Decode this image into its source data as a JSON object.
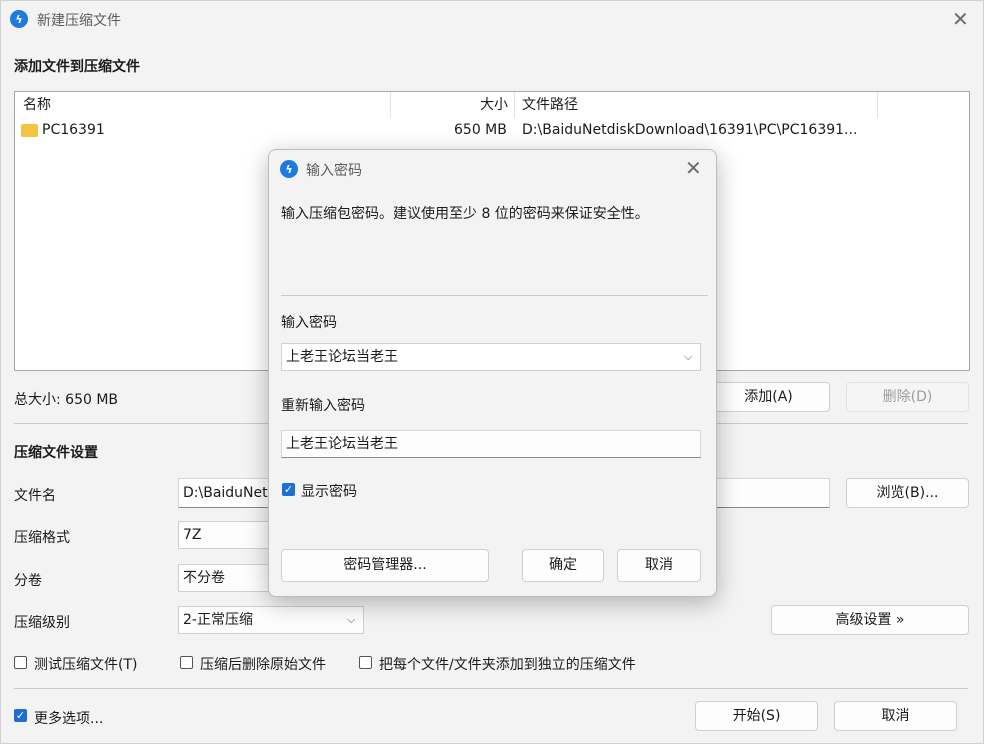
{
  "window": {
    "title": "新建压缩文件",
    "close": "✕"
  },
  "add_section": {
    "title": "添加文件到压缩文件",
    "columns": {
      "name": "名称",
      "size": "大小",
      "path": "文件路径"
    },
    "rows": [
      {
        "name": "PC16391",
        "size": "650 MB",
        "path": "D:\\BaiduNetdiskDownload\\16391\\PC\\PC16391..."
      }
    ],
    "total": "总大小: 650 MB",
    "add_label": "添加(A)",
    "delete_label": "删除(D)"
  },
  "settings": {
    "title": "压缩文件设置",
    "filename_label": "文件名",
    "filename_value": "D:\\BaiduNet",
    "browse_label": "浏览(B)...",
    "format_label": "压缩格式",
    "format_value": "7Z",
    "split_label": "分卷",
    "split_value": "不分卷",
    "level_label": "压缩级别",
    "level_value": "2-正常压缩",
    "advanced_label": "高级设置 »",
    "test_label": "测试压缩文件(T)",
    "delete_after_label": "压缩后删除原始文件",
    "separate_label": "把每个文件/文件夹添加到独立的压缩文件"
  },
  "footer": {
    "more_options": "更多选项...",
    "start": "开始(S)",
    "cancel": "取消"
  },
  "dialog": {
    "title": "输入密码",
    "description": "输入压缩包密码。建议使用至少 8 位的密码来保证安全性。",
    "password_label": "输入密码",
    "password_value": "上老王论坛当老王",
    "reenter_label": "重新输入密码",
    "reenter_value": "上老王论坛当老王",
    "show_password": "显示密码",
    "manager_label": "密码管理器...",
    "ok_label": "确定",
    "cancel_label": "取消",
    "close": "✕"
  },
  "colors": {
    "accent": "#1d6fd6",
    "folder": "#f3c444"
  }
}
